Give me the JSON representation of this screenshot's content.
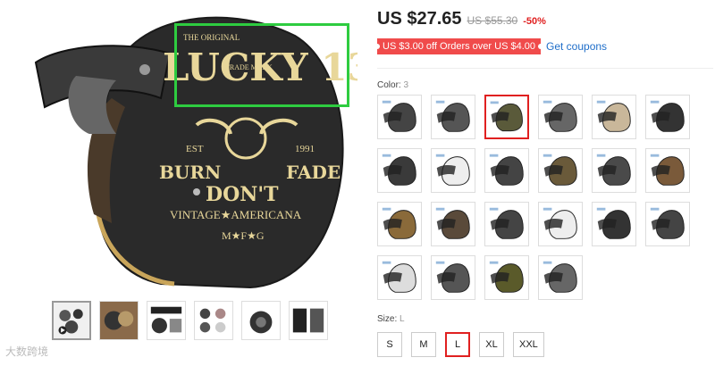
{
  "product": {
    "price": "US $27.65",
    "original_price": "US $55.30",
    "discount": "-50%"
  },
  "coupon": {
    "badge": "US $3.00 off Orders over US $4.00",
    "link": "Get coupons"
  },
  "color": {
    "label": "Color:",
    "selected_value": "3",
    "swatch_count": 22,
    "selected_index": 2
  },
  "size": {
    "label": "Size:",
    "selected_value": "L",
    "options": [
      "S",
      "M",
      "L",
      "XL",
      "XXL"
    ],
    "selected_index": 2
  },
  "helmet_art": {
    "line1": "THE ORIGINAL",
    "brand": "LUCKY 13",
    "trade": "TRADE MARK",
    "est": "EST",
    "year": "1991",
    "burn": "BURN",
    "dont": "DON'T",
    "fade": "FADE",
    "vintage": "VINTAGE★AMERICANA",
    "mfg": "M★F★G"
  },
  "watermark": "大数跨境",
  "colors": {
    "accent_red": "#e02020",
    "link_blue": "#1f6ec9",
    "coupon_red": "#f04b4b",
    "highlight_green": "#2ecc40"
  }
}
